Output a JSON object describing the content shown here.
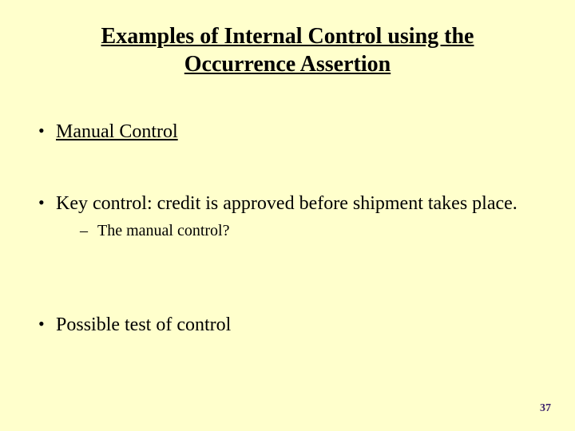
{
  "title": {
    "line1": "Examples of Internal Control using the",
    "line2": "Occurrence Assertion"
  },
  "bullets": {
    "item1": "Manual Control",
    "item2": "Key control: credit is approved before shipment takes place.",
    "item2_sub1": "The manual control?",
    "item3": "Possible test of control"
  },
  "page_number": "37"
}
